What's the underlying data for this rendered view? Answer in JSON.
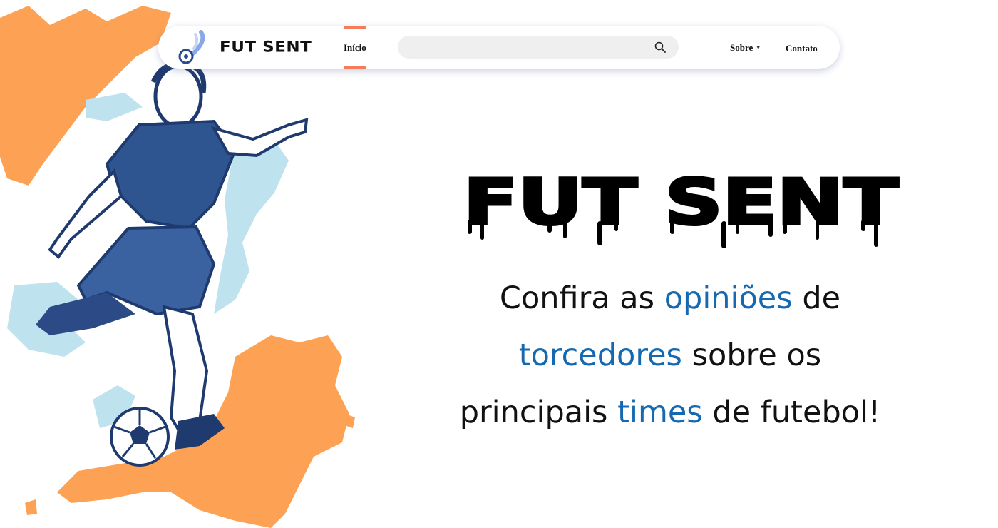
{
  "header": {
    "brand": {
      "name": "FUT SENT",
      "logo_icon": "comet-ball-icon"
    },
    "nav": {
      "inicio": {
        "label": "Início",
        "accent_color": "#f47c5a"
      },
      "sobre": {
        "label": "Sobre",
        "icon": "chevron-down-icon"
      },
      "contato": {
        "label": "Contato"
      }
    },
    "search": {
      "value": "",
      "placeholder": "",
      "icon": "search-icon"
    }
  },
  "hero": {
    "title": "FUT SENT",
    "title_style": "black dripping letters",
    "text": {
      "l1a": "Confira as",
      "l1b": "opiniões",
      "l1c": "de",
      "l2a": "torcedores",
      "l2b": "sobre os",
      "l3a": "principais",
      "l3b": "times",
      "l3c": "de futebol!"
    },
    "highlight_color": "#1469b0",
    "illustration": "soccer-player-kicking-ball-illustration"
  },
  "colors": {
    "paint_orange": "#fda254",
    "paint_blue": "#bfe2ef",
    "player_navy": "#1f3a6e",
    "text": "#111111"
  }
}
